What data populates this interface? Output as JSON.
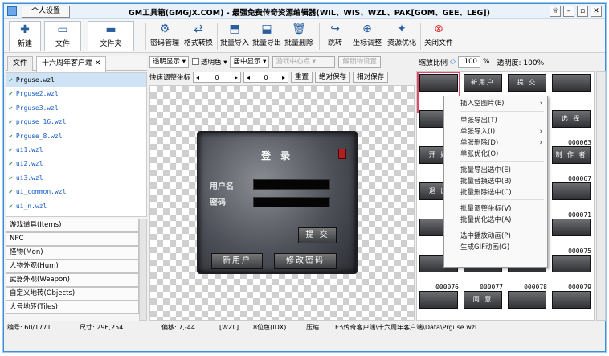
{
  "window": {
    "personal_tab": "个人设置",
    "title": "GM工具箱(GMGJX.COM) - 最强免费传奇资源编辑器(WIL、WIS、WZL、PAK[GOM、GEE、LEG])"
  },
  "toolbar": {
    "new": "新建",
    "file": "文件",
    "folder": "文件夹",
    "pwd": "密码管理",
    "fmt": "格式转换",
    "bimport": "批量导入",
    "bexport": "批量导出",
    "bdelete": "批量删除",
    "jump": "跳转",
    "coord": "坐标调整",
    "optimize": "资源优化",
    "close": "关闭文件"
  },
  "left": {
    "tab_file": "文件",
    "tab_client": "十六周年客户端",
    "files": [
      "Prguse.wzl",
      "Prguse2.wzl",
      "Prguse3.wzl",
      "prguse_16.wzl",
      "Prguse_8.wzl",
      "ui1.wzl",
      "ui2.wzl",
      "ui3.wzl",
      "ui_common.wzl",
      "ui_n.wzl"
    ],
    "categories": [
      "游戏道具(Items)",
      "NPC",
      "怪物(Mon)",
      "人物外观(Hum)",
      "武器外观(Weapon)",
      "自定义地砖(Objects)",
      "大号地砖(Tiles)"
    ]
  },
  "options": {
    "transparent_select": "透明显示",
    "transparent_color": "透明色",
    "center_select": "居中显示",
    "center_point": "游戏中心点",
    "unlock": "解锁物设置",
    "scale_label": "缩放比例",
    "scale_value": "100",
    "scale_unit": "%",
    "opacity": "透明度: 100%"
  },
  "adjust": {
    "label": "快速调整坐标",
    "x": "0",
    "y": "0",
    "reset": "重置",
    "abs_save": "绝对保存",
    "rel_save": "相对保存"
  },
  "login_image": {
    "title": "登 录",
    "user": "用户名",
    "pwd": "密码",
    "submit": "提 交",
    "new_user": "新用户",
    "change_pwd": "修改密码"
  },
  "thumbs": {
    "cells": [
      {
        "label": "",
        "id": ""
      },
      {
        "label": "新用户",
        "id": ""
      },
      {
        "label": "提 交",
        "id": ""
      },
      {
        "label": "",
        "id": ""
      },
      {
        "label": "",
        "id": ""
      },
      {
        "label": "",
        "id": ""
      },
      {
        "label": "",
        "id": ""
      },
      {
        "label": "选 择",
        "id": "000063"
      },
      {
        "label": "开 始",
        "id": ""
      },
      {
        "label": "",
        "id": ""
      },
      {
        "label": "",
        "id": ""
      },
      {
        "label": "制 作 者",
        "id": "000067"
      },
      {
        "label": "退 出",
        "id": ""
      },
      {
        "label": "",
        "id": ""
      },
      {
        "label": "",
        "id": ""
      },
      {
        "label": "",
        "id": "000071"
      },
      {
        "label": "",
        "id": ""
      },
      {
        "label": "",
        "id": ""
      },
      {
        "label": "",
        "id": ""
      },
      {
        "label": "",
        "id": "000075"
      },
      {
        "label": "",
        "id": "000076"
      },
      {
        "label": "",
        "id": "000077"
      },
      {
        "label": "",
        "id": "000078"
      },
      {
        "label": "",
        "id": "000079"
      },
      {
        "label": "",
        "id": ""
      },
      {
        "label": "同 意",
        "id": ""
      },
      {
        "label": "",
        "id": ""
      },
      {
        "label": "",
        "id": ""
      }
    ]
  },
  "context_menu": [
    {
      "label": "插入空图片(E)",
      "sub": true
    },
    {
      "label": "单张导出(T)",
      "sub": false
    },
    {
      "label": "单张导入(I)",
      "sub": true
    },
    {
      "label": "单张删除(D)",
      "sub": true
    },
    {
      "label": "单张优化(O)",
      "sub": false
    },
    {
      "label": "批量导出选中(E)",
      "sub": false
    },
    {
      "label": "批量替换选中(B)",
      "sub": false
    },
    {
      "label": "批量删除选中(C)",
      "sub": false
    },
    {
      "label": "批量调整坐标(V)",
      "sub": false
    },
    {
      "label": "批量优化选中(A)",
      "sub": false
    },
    {
      "label": "选中播放动画(P)",
      "sub": false
    },
    {
      "label": "生成GIF动画(G)",
      "sub": false
    }
  ],
  "status": {
    "index": "编号: 60/1771",
    "size": "尺寸: 296,254",
    "offset": "偏移: 7,-44",
    "type": "[WZL]",
    "color": "8位色(IDX)",
    "compress": "压缩",
    "path": "E:\\传奇客户端\\十六周年客户端\\Data\\Prguse.wzl"
  }
}
